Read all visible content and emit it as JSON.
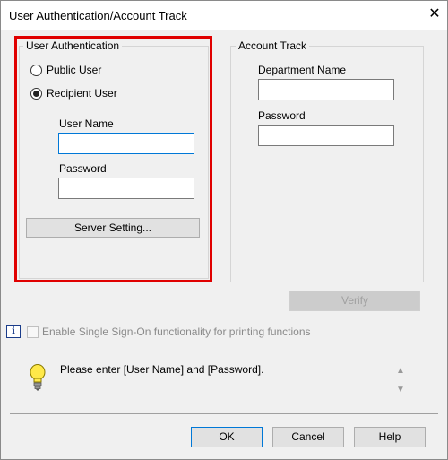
{
  "window": {
    "title": "User Authentication/Account Track",
    "close_glyph": "✕"
  },
  "user_auth": {
    "group_label": "User Authentication",
    "public_user_label": "Public User",
    "recipient_user_label": "Recipient User",
    "selected": "recipient",
    "user_name_label": "User Name",
    "user_name_value": "",
    "password_label": "Password",
    "password_value": "",
    "server_setting_button": "Server Setting..."
  },
  "account_track": {
    "group_label": "Account Track",
    "department_name_label": "Department Name",
    "department_name_value": "",
    "password_label": "Password",
    "password_value": ""
  },
  "verify_button": "Verify",
  "sso_checkbox": {
    "label": "Enable Single Sign-On functionality for printing functions",
    "checked": false,
    "enabled": false
  },
  "message": {
    "icon": "lightbulb-icon",
    "text": "Please enter [User Name] and [Password]."
  },
  "footer": {
    "ok": "OK",
    "cancel": "Cancel",
    "help": "Help"
  },
  "colors": {
    "highlight_frame": "#e00000",
    "focus": "#0078d7"
  }
}
